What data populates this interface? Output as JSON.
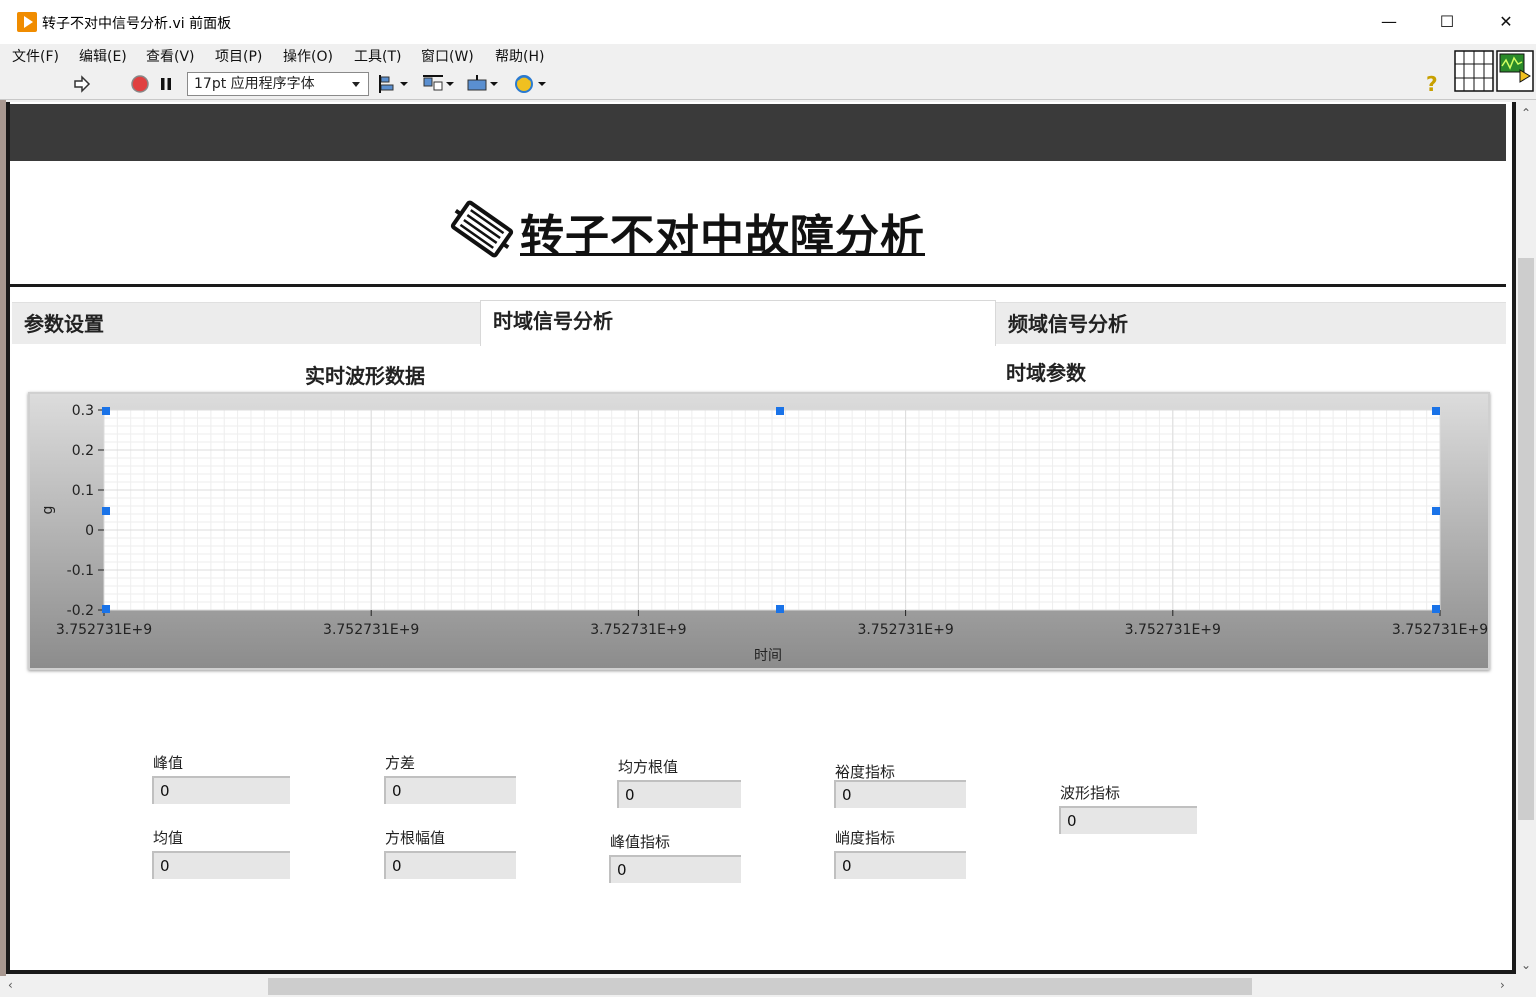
{
  "window": {
    "title": "转子不对中信号分析.vi 前面板",
    "minimize": "—",
    "maximize": "☐",
    "close": "✕"
  },
  "menu": [
    "文件(F)",
    "编辑(E)",
    "查看(V)",
    "项目(P)",
    "操作(O)",
    "工具(T)",
    "窗口(W)",
    "帮助(H)"
  ],
  "toolbar": {
    "font": "17pt 应用程序字体",
    "help": "?"
  },
  "panel": {
    "title": "转子不对中故障分析"
  },
  "tabs": [
    "参数设置",
    "时域信号分析",
    "频域信号分析"
  ],
  "active_tab": "时域信号分析",
  "sections": {
    "waveform": "实时波形数据",
    "params": "时域参数"
  },
  "chart_data": {
    "type": "line",
    "title": "",
    "xlabel": "时间",
    "ylabel": "g",
    "ylim": [
      -0.2,
      0.3
    ],
    "yticks": [
      "0.3",
      "0.2",
      "0.1",
      "0",
      "-0.1",
      "-0.2"
    ],
    "xticks": [
      "3.752731E+9",
      "3.752731E+9",
      "3.752731E+9",
      "3.752731E+9",
      "3.752731E+9",
      "3.752731E+9"
    ],
    "series": [],
    "grid": true
  },
  "indicators": [
    {
      "label": "峰值",
      "value": "0"
    },
    {
      "label": "方差",
      "value": "0"
    },
    {
      "label": "均方根值",
      "value": "0"
    },
    {
      "label": "裕度指标",
      "value": "0"
    },
    {
      "label": "波形指标",
      "value": "0"
    },
    {
      "label": "均值",
      "value": "0"
    },
    {
      "label": "方根幅值",
      "value": "0"
    },
    {
      "label": "峰值指标",
      "value": "0"
    },
    {
      "label": "峭度指标",
      "value": "0"
    }
  ],
  "colors": {
    "accent": "#f08c00",
    "selection_handle": "#1a73e8",
    "frame": "#1a1a1a",
    "header": "#3a3a3a"
  }
}
